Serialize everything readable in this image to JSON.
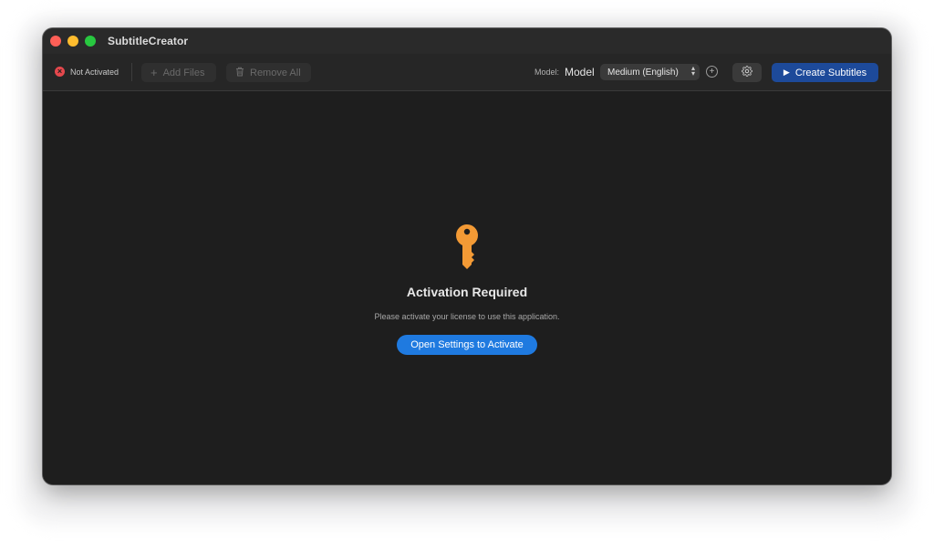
{
  "window": {
    "title": "SubtitleCreator"
  },
  "toolbar": {
    "status_text": "Not Activated",
    "add_files_label": "Add Files",
    "remove_all_label": "Remove All",
    "model_label": "Model:",
    "model_title": "Model",
    "model_selected": "Medium (English)",
    "create_label": "Create Subtitles"
  },
  "main": {
    "title": "Activation Required",
    "subtitle": "Please activate your license to use this application.",
    "button_label": "Open Settings to Activate"
  },
  "icons": {
    "status": "x-circle-icon",
    "add": "plus-icon",
    "remove": "trash-icon",
    "select": "chevron-up-down-icon",
    "add_model": "plus-circle-icon",
    "settings": "gear-icon",
    "create": "play-icon",
    "activation": "key-icon"
  },
  "colors": {
    "window_bg": "#1e1e1e",
    "toolbar_bg": "#262626",
    "status_red": "#e5484d",
    "accent_blue": "#1f7ae0",
    "create_blue": "#1d4a9a",
    "key_orange": "#f39a35"
  }
}
